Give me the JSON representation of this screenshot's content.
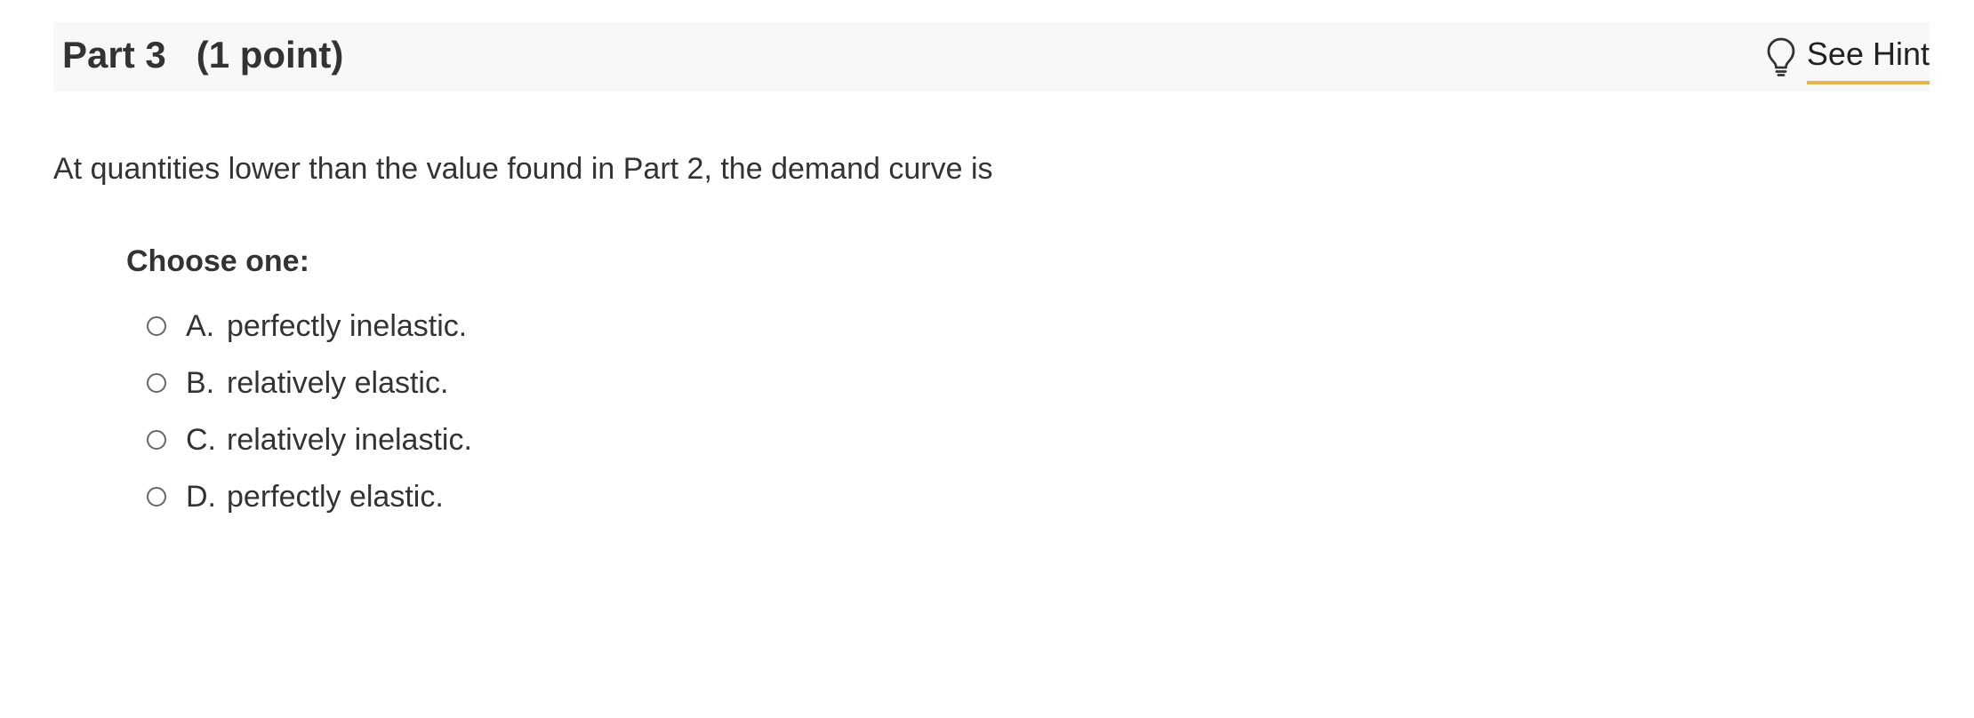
{
  "part": {
    "title": "Part 3",
    "points": "(1 point)"
  },
  "hint": {
    "label": "See Hint",
    "icon": "lightbulb-icon",
    "underline_color": "#e4b74c"
  },
  "question": {
    "text": "At quantities lower than the value found in Part 2, the demand curve is"
  },
  "choices": {
    "prompt": "Choose one:",
    "options": [
      {
        "letter": "A.",
        "text": "perfectly inelastic.",
        "selected": false
      },
      {
        "letter": "B.",
        "text": "relatively elastic.",
        "selected": false
      },
      {
        "letter": "C.",
        "text": "relatively inelastic.",
        "selected": false
      },
      {
        "letter": "D.",
        "text": "perfectly elastic.",
        "selected": false
      }
    ]
  }
}
